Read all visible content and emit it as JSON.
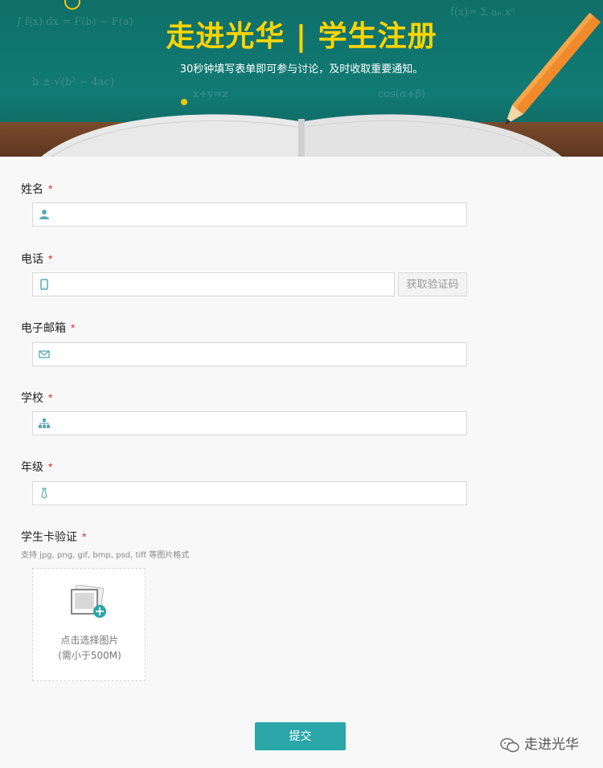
{
  "banner": {
    "title": "走进光华 | 学生注册",
    "subtitle": "30秒钟填写表单即可参与讨论，及时收取重要通知。"
  },
  "form": {
    "name": {
      "label": "姓名",
      "required": "*",
      "icon": "user-icon",
      "value": "",
      "placeholder": ""
    },
    "phone": {
      "label": "电话",
      "required": "*",
      "icon": "phone-icon",
      "value": "",
      "placeholder": "",
      "code_button": "获取验证码"
    },
    "email": {
      "label": "电子邮箱",
      "required": "*",
      "icon": "mail-icon",
      "value": "",
      "placeholder": ""
    },
    "school": {
      "label": "学校",
      "required": "*",
      "icon": "sitemap-icon",
      "value": "",
      "placeholder": ""
    },
    "grade": {
      "label": "年级",
      "required": "*",
      "icon": "tie-icon",
      "value": "",
      "placeholder": ""
    },
    "student_card": {
      "label": "学生卡验证",
      "required": "*",
      "hint": "支持 jpg, png, gif, bmp, psd, tiff 等图片格式",
      "upload_text": "点击选择图片",
      "upload_limit": "(需小于500M)"
    },
    "submit_label": "提交"
  },
  "watermark": {
    "text": "走进光华",
    "icon": "wechat-icon"
  },
  "colors": {
    "accent": "#2aa6a9",
    "title_yellow": "#ffd400",
    "required_red": "#d9342b",
    "icon_teal": "#5aa9b7"
  }
}
